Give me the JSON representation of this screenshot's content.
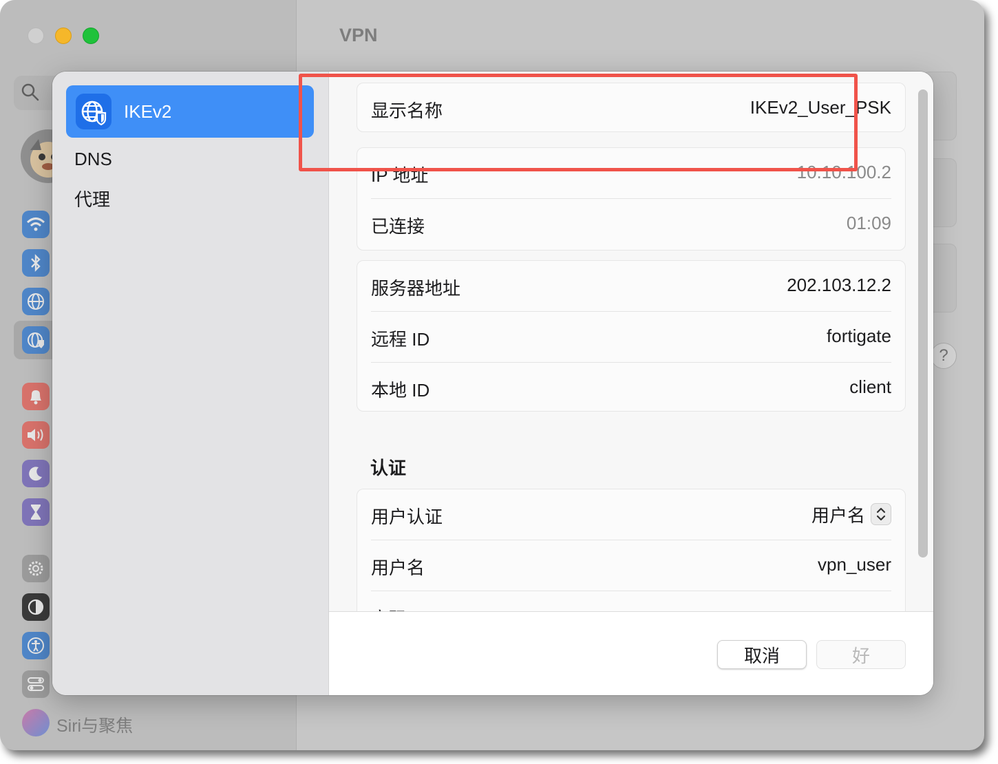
{
  "window": {
    "title": "VPN",
    "sidebar_partial_item": "Siri与聚焦"
  },
  "sheet": {
    "sidebar": {
      "selected": "IKEv2",
      "items": [
        "DNS",
        "代理"
      ]
    },
    "group1": [
      {
        "label": "显示名称",
        "value": "IKEv2_User_PSK"
      }
    ],
    "status": [
      {
        "label": "IP 地址",
        "value": "10.10.100.2"
      },
      {
        "label": "已连接",
        "value": "01:09"
      }
    ],
    "server": [
      {
        "label": "服务器地址",
        "value": "202.103.12.2"
      },
      {
        "label": "远程 ID",
        "value": "fortigate"
      },
      {
        "label": "本地 ID",
        "value": "client"
      }
    ],
    "auth": {
      "title": "认证",
      "user_auth_label": "用户认证",
      "user_auth_value": "用户名",
      "username_label": "用户名",
      "username_value": "vpn_user",
      "password_label": "密码"
    },
    "buttons": {
      "cancel": "取消",
      "ok": "好"
    }
  },
  "colors": {
    "accent": "#3f8ff7",
    "highlight": "#f0534a",
    "traffic_min": "#f5b72a",
    "traffic_max": "#1fc23b"
  },
  "icons": {
    "vpn": "globe-shield-icon",
    "wifi": "wifi-icon",
    "bluetooth": "bluetooth-icon",
    "network": "globe-icon",
    "notifications": "bell-icon",
    "sound": "speaker-icon",
    "focus": "moon-icon",
    "screen_time": "hourglass-icon",
    "general": "gear-icon",
    "appearance": "appearance-icon",
    "accessibility": "accessibility-icon",
    "control_center": "toggles-icon"
  }
}
